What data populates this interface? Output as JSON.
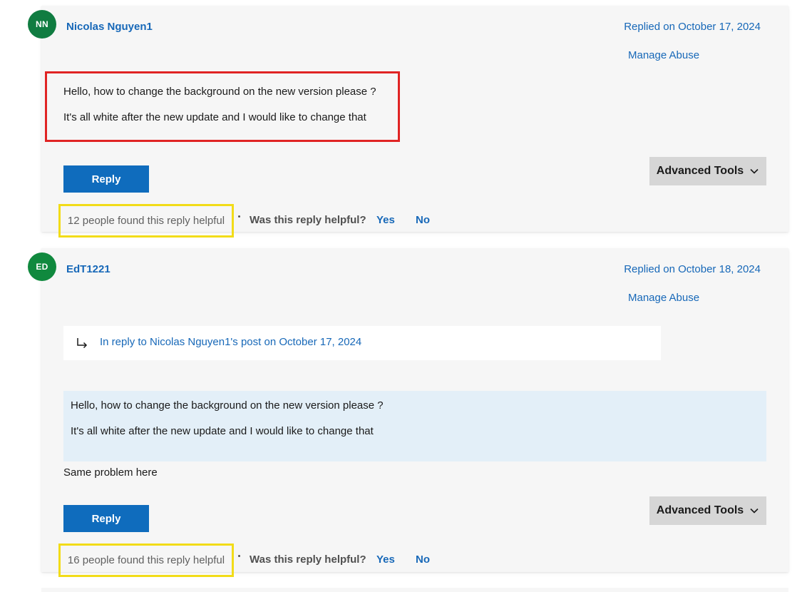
{
  "posts": [
    {
      "avatar_initials": "NN",
      "avatar_color": "#107c41",
      "author": "Nicolas Nguyen1",
      "replied_on": "Replied on October 17, 2024",
      "manage_abuse": "Manage Abuse",
      "body": [
        "Hello, how to change the background on the new version please ?",
        "It's all white after the new update and I would like to change that"
      ],
      "reply_label": "Reply",
      "advanced_tools_label": "Advanced Tools",
      "helpful_count": "12 people found this reply helpful",
      "helpful_question": "Was this reply helpful?",
      "yes_label": "Yes",
      "no_label": "No"
    },
    {
      "avatar_initials": "ED",
      "avatar_color": "#10893e",
      "author": "EdT1221",
      "replied_on": "Replied on October 18, 2024",
      "manage_abuse": "Manage Abuse",
      "in_reply_to": "In reply to Nicolas Nguyen1's post on October 17, 2024",
      "quote": [
        "Hello, how to change the background on the new version please ?",
        "It's all white after the new update and I would like to change that"
      ],
      "body": "Same problem here",
      "reply_label": "Reply",
      "advanced_tools_label": "Advanced Tools",
      "helpful_count": "16 people found this reply helpful",
      "helpful_question": "Was this reply helpful?",
      "yes_label": "Yes",
      "no_label": "No"
    }
  ],
  "colors": {
    "link": "#1768b8",
    "primary_button": "#0f6cbd",
    "highlight_red": "#e02424",
    "highlight_yellow": "#f2dc18",
    "quote_background": "#e3eff8"
  }
}
